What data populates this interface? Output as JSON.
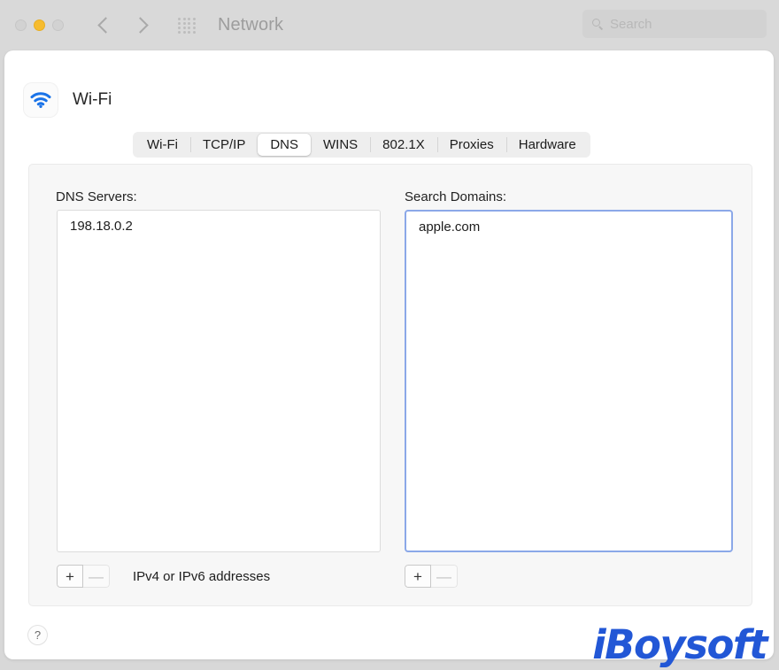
{
  "window": {
    "title": "Network",
    "traffic_lights": [
      {
        "name": "close",
        "color": "#d2d2d2"
      },
      {
        "name": "minimize",
        "color": "#f6bc2f"
      },
      {
        "name": "zoom",
        "color": "#d2d2d2"
      }
    ],
    "nav_back_icon": "chevron-left-icon",
    "nav_forward_icon": "chevron-forward-icon",
    "grid_icon": "show-all-grid-icon"
  },
  "search": {
    "placeholder": "Search",
    "value": "",
    "icon": "search-icon"
  },
  "interface": {
    "icon": "wifi-icon",
    "name": "Wi-Fi"
  },
  "tabs": [
    {
      "label": "Wi-Fi",
      "selected": false
    },
    {
      "label": "TCP/IP",
      "selected": false
    },
    {
      "label": "DNS",
      "selected": true
    },
    {
      "label": "WINS",
      "selected": false
    },
    {
      "label": "802.1X",
      "selected": false
    },
    {
      "label": "Proxies",
      "selected": false
    },
    {
      "label": "Hardware",
      "selected": false
    }
  ],
  "dns_servers": {
    "label": "DNS Servers:",
    "entries": [
      "198.18.0.2"
    ],
    "add_label": "+",
    "remove_label": "—",
    "hint": "IPv4 or IPv6 addresses"
  },
  "search_domains": {
    "label": "Search Domains:",
    "entries": [
      "apple.com"
    ],
    "add_label": "+",
    "remove_label": "—",
    "focused": true,
    "focus_color": "#8ba8e8"
  },
  "help": {
    "label": "?"
  },
  "watermark": {
    "text": "iBoysoft",
    "color": "#2257d6"
  }
}
